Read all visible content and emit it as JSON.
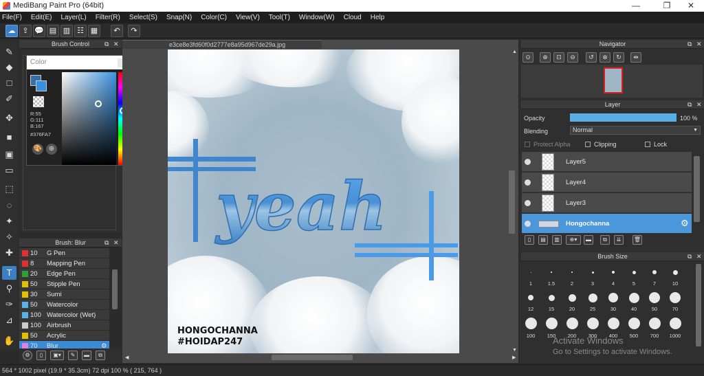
{
  "window": {
    "title": "MediBang Paint Pro (64bit)",
    "minimize": "—",
    "maximize": "❐",
    "close": "✕"
  },
  "menu": [
    "File(F)",
    "Edit(E)",
    "Layer(L)",
    "Filter(R)",
    "Select(S)",
    "Snap(N)",
    "Color(C)",
    "View(V)",
    "Tool(T)",
    "Window(W)",
    "Cloud",
    "Help"
  ],
  "toolbar": {
    "icons": [
      "cloud-sync-icon",
      "upload-icon",
      "comment-icon",
      "page-icon",
      "manage-icon",
      "panel-icon",
      "grid-icon",
      "undo-icon",
      "redo-icon"
    ],
    "glyphs": [
      "☁",
      "⇪",
      "💬",
      "▤",
      "▥",
      "☷",
      "▦",
      "↶",
      "↷"
    ]
  },
  "tools": {
    "glyphs": [
      "✎",
      "◆",
      "□",
      "✐",
      "✥",
      "■",
      "▣",
      "▭",
      "⬚",
      "◌",
      "✦",
      "✧",
      "✚",
      "T",
      "⚲",
      "✑",
      "⊿",
      "✋"
    ],
    "names": [
      "brush-tool-icon",
      "eraser-tool-icon",
      "dot-tool-icon",
      "line-tool-icon",
      "move-tool-icon",
      "fill-rect-icon",
      "bucket-icon",
      "gradient-icon",
      "select-icon",
      "lasso-icon",
      "magic-wand-icon",
      "select-pen-icon",
      "select-eraser-icon",
      "text-tool-icon",
      "operation-icon",
      "eyedropper-icon",
      "divide-icon",
      "hand-icon"
    ],
    "selected": 13
  },
  "brush_control": {
    "title": "Brush Control"
  },
  "color": {
    "title": "Color",
    "r": "R:55",
    "g": "G:111",
    "b": "B:167",
    "hex": "#376FA7",
    "primary": "#376fa7",
    "secondary": "#3a8fe0"
  },
  "brush_list": {
    "title": "Brush: Blur",
    "items": [
      {
        "size": "10",
        "name": "G Pen",
        "color": "#e03030"
      },
      {
        "size": "8",
        "name": "Mapping Pen",
        "color": "#e03030"
      },
      {
        "size": "20",
        "name": "Edge Pen",
        "color": "#2fa02f"
      },
      {
        "size": "50",
        "name": "Stipple Pen",
        "color": "#e0c000"
      },
      {
        "size": "30",
        "name": "Sumi",
        "color": "#e0c000"
      },
      {
        "size": "50",
        "name": "Watercolor",
        "color": "#5ab0e8"
      },
      {
        "size": "100",
        "name": "Watercolor (Wet)",
        "color": "#5ab0e8"
      },
      {
        "size": "100",
        "name": "Airbrush",
        "color": "#cccccc"
      },
      {
        "size": "50",
        "name": "Acrylic",
        "color": "#e0c000"
      },
      {
        "size": "70",
        "name": "Blur",
        "color": "#e080e0"
      }
    ],
    "selected": 9
  },
  "document": {
    "tab": "e3ce8e3fd60f0d2777e8a95d967de29a.jpg",
    "art_word": "yeah",
    "watermark1": "HONGOCHANNA",
    "watermark2": "#HOIDAP247"
  },
  "navigator": {
    "title": "Navigator"
  },
  "layer": {
    "title": "Layer",
    "opacity_label": "Opacity",
    "opacity_value": "100 %",
    "opacity": 1.0,
    "blending_label": "Blending",
    "blending_value": "Normal",
    "protect_alpha": "Protect Alpha",
    "clipping": "Clipping",
    "lock": "Lock",
    "layers": [
      "Layer5",
      "Layer4",
      "Layer3",
      "Hongochanna"
    ],
    "selected": 3
  },
  "brush_size": {
    "title": "Brush Size",
    "sizes": [
      "1",
      "1.5",
      "2",
      "3",
      "4",
      "5",
      "7",
      "10",
      "12",
      "15",
      "20",
      "25",
      "30",
      "40",
      "50",
      "70",
      "100",
      "150",
      "200",
      "300",
      "400",
      "500",
      "700",
      "1000"
    ]
  },
  "status": {
    "text": "564 * 1002 pixel  (19.9 * 35.3cm)  72 dpi  100 %  ( 215, 764 )"
  },
  "activation": {
    "line1": "Activate Windows",
    "line2": "Go to Settings to activate Windows."
  }
}
